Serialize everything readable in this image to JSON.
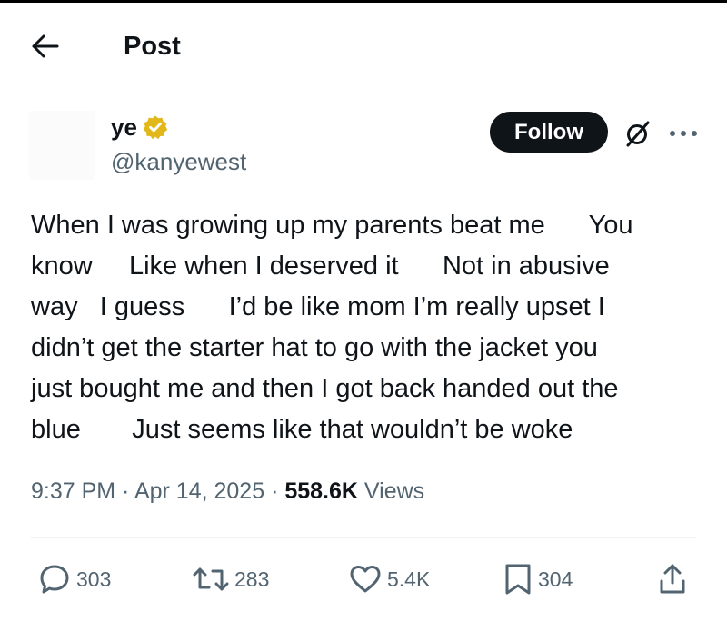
{
  "header": {
    "title": "Post",
    "back_icon": "arrow-left-icon"
  },
  "author": {
    "name": "ye",
    "handle": "@kanyewest",
    "verified_icon": "verified-badge-icon",
    "verified_color": "#E2B719"
  },
  "follow_button": {
    "label": "Follow"
  },
  "post": {
    "lines": [
      "When I was growing up my parents beat me      You",
      "know     Like when I deserved it      Not in abusive",
      "way   I guess      I’d be like mom I’m really upset I",
      "didn’t get the starter hat to go with the jacket you",
      "just bought me and then I got back handed out the",
      "blue       Just seems like that wouldn’t be woke"
    ]
  },
  "meta": {
    "time": "9:37 PM",
    "date": "Apr 14, 2025",
    "separator": " · ",
    "views_count": "558.6K",
    "views_label": " Views"
  },
  "actions": {
    "replies": "303",
    "reposts": "283",
    "likes": "5.4K",
    "bookmarks": "304"
  },
  "colors": {
    "text": "#0f1419",
    "secondary": "#536471",
    "button_bg": "#0f1419"
  }
}
